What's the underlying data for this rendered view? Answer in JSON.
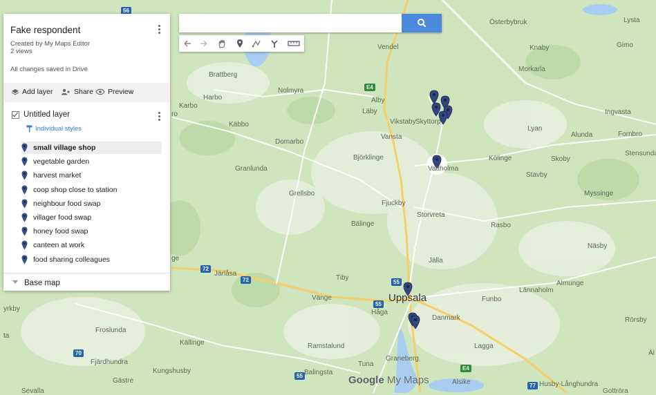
{
  "panel": {
    "title": "Fake respondent",
    "created_by": "Created by My Maps Editor",
    "views": "2 views",
    "save_status": "All changes saved in Drive",
    "actions": {
      "add_layer": "Add layer",
      "share": "Share",
      "preview": "Preview"
    },
    "layer": {
      "name": "Untitled layer",
      "style_link": "Individual styles",
      "features": [
        "small village shop",
        "vegetable garden",
        "harvest market",
        "coop shop close to station",
        "neighbour food swap",
        "villager food swap",
        "honey food swap",
        "canteen at work",
        "food sharing colleagues"
      ]
    },
    "base_map": "Base map"
  },
  "search": {
    "placeholder": "",
    "value": ""
  },
  "map": {
    "branding": {
      "google": "Google",
      "product": "My Maps"
    },
    "places": {
      "osterbybruk": "Österbybruk",
      "lysta": "Lysta",
      "vendel": "Vendel",
      "knaby": "Knaby",
      "gimo": "Gimo",
      "brattberg": "Brattberg",
      "morkarla": "Morkarla",
      "harbo": "Harbo",
      "nolmyra": "Nolmyra",
      "alby": "Alby",
      "karbo": "Karbo",
      "laby": "Läby",
      "ingvasta": "Ingvasta",
      "vikstaby": "Vikstaby",
      "skyttorp": "Skyttorp",
      "kabbo": "Käbbo",
      "lyan": "Lyan",
      "alunda": "Alunda",
      "fornbro": "Fornbro",
      "domarbo": "Domarbo",
      "vansta": "Vansta",
      "stensunda": "Stensunda",
      "bjorklinge": "Björklinge",
      "kolinge": "Kölinge",
      "skoby": "Skoby",
      "granlunda": "Granlunda",
      "vattholma": "Vattholma",
      "stavby": "Stavby",
      "grellsbo": "Grellsbo",
      "myssinge": "Myssinge",
      "fjuckby": "Fjuckby",
      "storvreta": "Storvreta",
      "balinge": "Bälinge",
      "rasbo": "Rasbo",
      "nasby": "Näsby",
      "jalla": "Jälla",
      "jarlasa": "Järlåsa",
      "tiby": "Tiby",
      "almunge": "Almunge",
      "lannaholm": "Lännaholm",
      "uppsala": "Uppsala",
      "vange": "Vänge",
      "funbo": "Funbo",
      "haga": "Håga",
      "danmark": "Danmark",
      "yrkby": "yrkby",
      "rorsby": "Rörsby",
      "froslunda": "Froslunda",
      "kallinge": "Källinge",
      "ramstalund": "Ramstalund",
      "lagga": "Lagga",
      "fjardhundra": "Fjärdhundra",
      "graneberg": "Graneberg",
      "tuna": "Tuna",
      "kungshusby": "Kungshusby",
      "balingsta": "Balingsta",
      "alsike": "Alsike",
      "gastre": "Gästre",
      "husby": "Husby-Långhundra",
      "sevalla": "Sevalla",
      "gottrora": "Gottröra",
      "ta": "ta",
      "ge": "ge",
      "ro": "ro",
      "alt": "Äl"
    },
    "road_shields": {
      "r56": "56",
      "e4": "E4",
      "r72a": "72",
      "r72b": "72",
      "r55a": "55",
      "r55b": "55",
      "r70": "70",
      "r55c": "55",
      "e4b": "E4",
      "r77": "77"
    }
  }
}
